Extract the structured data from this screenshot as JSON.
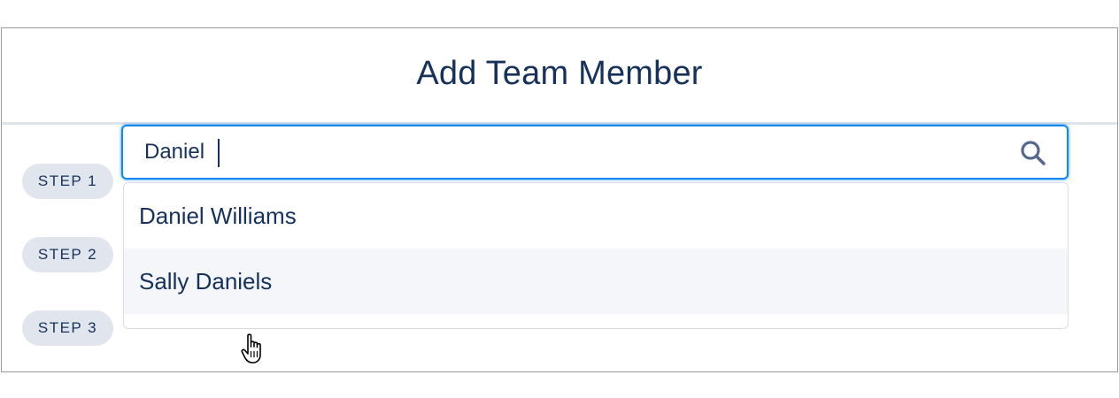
{
  "modal": {
    "title": "Add Team Member"
  },
  "steps": [
    {
      "label": "STEP 1"
    },
    {
      "label": "STEP 2"
    },
    {
      "label": "STEP 3"
    }
  ],
  "search": {
    "value": "Daniel",
    "icon": "search-icon"
  },
  "results": [
    {
      "name": "Daniel Williams",
      "hovered": false
    },
    {
      "name": "Sally Daniels",
      "hovered": true
    }
  ],
  "colors": {
    "text": "#16325c",
    "focus_border": "#1589ee",
    "pill_bg": "#e0e5ee",
    "hover_bg": "#f4f6f9"
  },
  "cursor": "pointer-hand-icon"
}
